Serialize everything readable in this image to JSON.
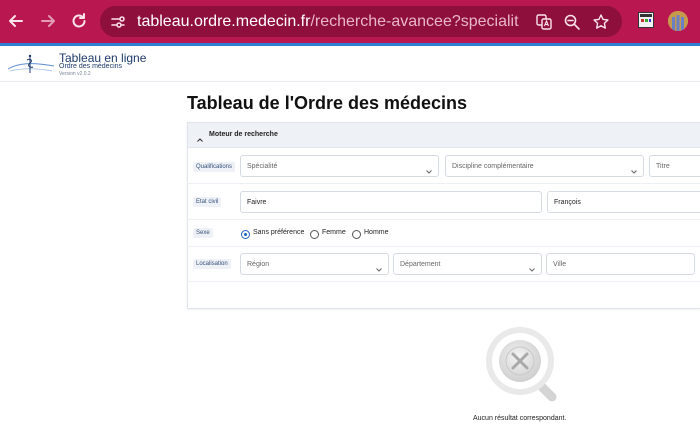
{
  "browser": {
    "url_host": "tableau.ordre.medecin.fr",
    "url_path": "/recherche-avancee?specialite=&discipl...",
    "icons": [
      "back-arrow-icon",
      "forward-arrow-icon",
      "reload-icon",
      "site-info-icon",
      "translate-icon",
      "zoom-icon",
      "bookmark-star-icon",
      "extension-icon",
      "profile-avatar-icon"
    ],
    "colors": {
      "frame": "#b8174f",
      "omnibox": "#8e0f3c",
      "accent": "#2f7fd6"
    }
  },
  "site": {
    "brand_title": "Tableau en ligne",
    "brand_subtitle": "Ordre des médecins",
    "version": "Version v2.0.2"
  },
  "page": {
    "title": "Tableau de l'Ordre des médecins"
  },
  "search": {
    "panel_title": "Moteur de recherche",
    "qualifications": {
      "label": "Qualifications",
      "specialite": "Spécialité",
      "discipline": "Discipline complémentaire",
      "titre": "Titre"
    },
    "etat_civil": {
      "label": "Etat civil",
      "nom": "Faivre",
      "prenom": "François"
    },
    "sexe": {
      "label": "Sexe",
      "options": [
        "Sans préférence",
        "Femme",
        "Homme"
      ],
      "selected": "Sans préférence"
    },
    "localisation": {
      "label": "Localisation",
      "region": "Région",
      "departement": "Département",
      "ville": "Ville"
    }
  },
  "results": {
    "empty_message": "Aucun résultat correspondant."
  }
}
